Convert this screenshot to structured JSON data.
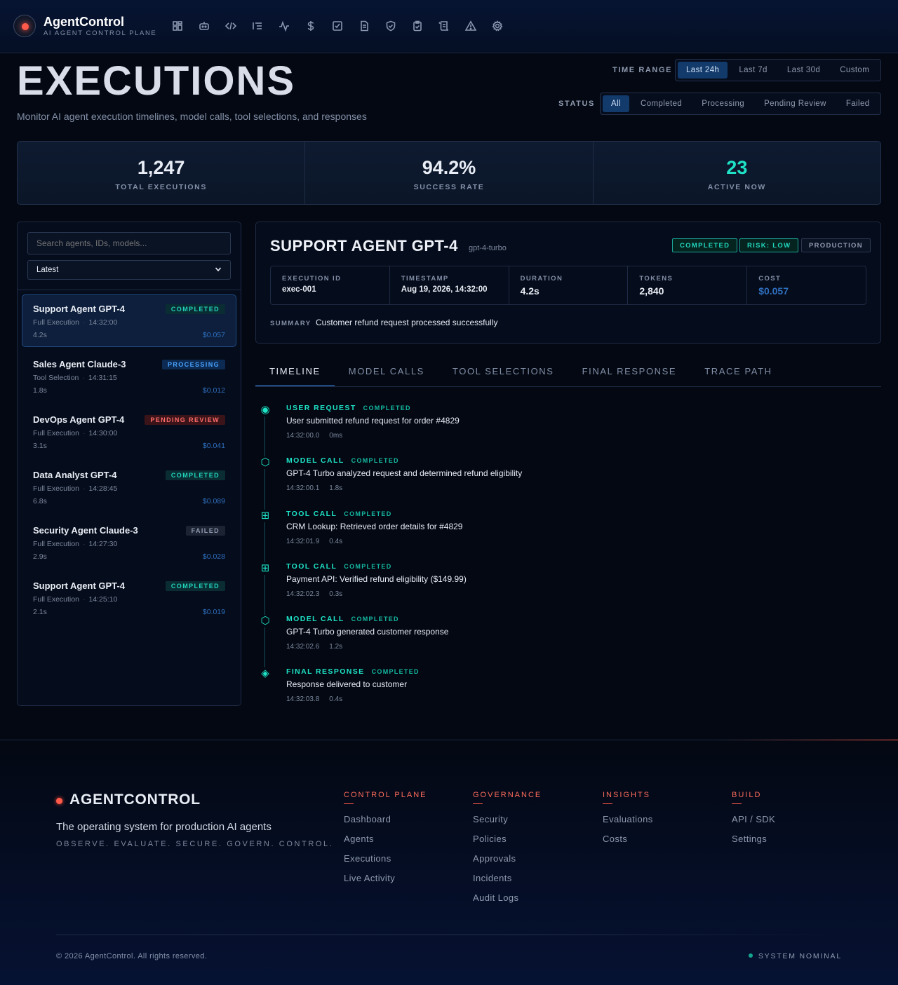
{
  "app": {
    "title": "AgentControl",
    "subtitle": "AI AGENT CONTROL PLANE"
  },
  "nav": {
    "icons": [
      "dashboard-icon",
      "agent-icon",
      "code-icon",
      "list-icon",
      "activity-icon",
      "dollar-icon",
      "checkbox-icon",
      "document-icon",
      "shield-icon",
      "clipboard-icon",
      "scroll-icon",
      "warning-icon",
      "gear-icon"
    ]
  },
  "page": {
    "title": "EXECUTIONS",
    "subtitle": "Monitor AI agent execution timelines, model calls, tool selections, and responses"
  },
  "filters": {
    "time_range_label": "TIME RANGE",
    "time_range_options": [
      "Last 24h",
      "Last 7d",
      "Last 30d",
      "Custom"
    ],
    "time_range_selected": "Last 24h",
    "status_label": "STATUS",
    "status_options": [
      "All",
      "Completed",
      "Processing",
      "Pending Review",
      "Failed"
    ],
    "status_selected": "All"
  },
  "stats": [
    {
      "value": "1,247",
      "label": "TOTAL EXECUTIONS"
    },
    {
      "value": "94.2%",
      "label": "SUCCESS RATE"
    },
    {
      "value": "23",
      "label": "ACTIVE NOW"
    }
  ],
  "list": {
    "search_placeholder": "Search agents, IDs, models...",
    "sort_value": "Latest",
    "items": [
      {
        "name": "Support Agent GPT-4",
        "status": "COMPLETED",
        "type": "Full Execution",
        "time": "14:32:00",
        "duration": "4.2s",
        "cost": "$0.057"
      },
      {
        "name": "Sales Agent Claude-3",
        "status": "PROCESSING",
        "type": "Tool Selection",
        "time": "14:31:15",
        "duration": "1.8s",
        "cost": "$0.012"
      },
      {
        "name": "DevOps Agent GPT-4",
        "status": "PENDING REVIEW",
        "type": "Full Execution",
        "time": "14:30:00",
        "duration": "3.1s",
        "cost": "$0.041"
      },
      {
        "name": "Data Analyst GPT-4",
        "status": "COMPLETED",
        "type": "Full Execution",
        "time": "14:28:45",
        "duration": "6.8s",
        "cost": "$0.089"
      },
      {
        "name": "Security Agent Claude-3",
        "status": "FAILED",
        "type": "Full Execution",
        "time": "14:27:30",
        "duration": "2.9s",
        "cost": "$0.028"
      },
      {
        "name": "Support Agent GPT-4",
        "status": "COMPLETED",
        "type": "Full Execution",
        "time": "14:25:10",
        "duration": "2.1s",
        "cost": "$0.019"
      }
    ]
  },
  "detail": {
    "title": "SUPPORT AGENT GPT-4",
    "model": "gpt-4-turbo",
    "tags": {
      "status": "COMPLETED",
      "risk": "RISK: LOW",
      "env": "PRODUCTION"
    },
    "meta": [
      {
        "label": "EXECUTION ID",
        "value": "exec-001"
      },
      {
        "label": "TIMESTAMP",
        "value": "Aug 19, 2026, 14:32:00"
      },
      {
        "label": "DURATION",
        "value": "4.2s"
      },
      {
        "label": "TOKENS",
        "value": "2,840"
      },
      {
        "label": "COST",
        "value": "$0.057"
      }
    ],
    "summary_label": "SUMMARY",
    "summary": "Customer refund request processed successfully"
  },
  "tabs": [
    "TIMELINE",
    "MODEL CALLS",
    "TOOL SELECTIONS",
    "FINAL RESPONSE",
    "TRACE PATH"
  ],
  "tabs_active": "TIMELINE",
  "timeline": [
    {
      "icon": "◉",
      "icon_name": "target-icon",
      "type": "USER REQUEST",
      "status": "COMPLETED",
      "desc": "User submitted refund request for order #4829",
      "time": "14:32:00.0",
      "dur": "0ms"
    },
    {
      "icon": "⬡",
      "icon_name": "hexagon-icon",
      "type": "MODEL CALL",
      "status": "COMPLETED",
      "desc": "GPT-4 Turbo analyzed request and determined refund eligibility",
      "time": "14:32:00.1",
      "dur": "1.8s"
    },
    {
      "icon": "⊞",
      "icon_name": "grid-icon",
      "type": "TOOL CALL",
      "status": "COMPLETED",
      "desc": "CRM Lookup: Retrieved order details for #4829",
      "time": "14:32:01.9",
      "dur": "0.4s"
    },
    {
      "icon": "⊞",
      "icon_name": "grid-icon",
      "type": "TOOL CALL",
      "status": "COMPLETED",
      "desc": "Payment API: Verified refund eligibility ($149.99)",
      "time": "14:32:02.3",
      "dur": "0.3s"
    },
    {
      "icon": "⬡",
      "icon_name": "hexagon-icon",
      "type": "MODEL CALL",
      "status": "COMPLETED",
      "desc": "GPT-4 Turbo generated customer response",
      "time": "14:32:02.6",
      "dur": "1.2s"
    },
    {
      "icon": "◈",
      "icon_name": "diamond-icon",
      "type": "FINAL RESPONSE",
      "status": "COMPLETED",
      "desc": "Response delivered to customer",
      "time": "14:32:03.8",
      "dur": "0.4s"
    }
  ],
  "footer": {
    "brand": "AGENTCONTROL",
    "tagline": "The operating system for production AI agents",
    "motto": "OBSERVE. EVALUATE. SECURE. GOVERN. CONTROL.",
    "columns": [
      {
        "title": "CONTROL PLANE",
        "links": [
          "Dashboard",
          "Agents",
          "Executions",
          "Live Activity"
        ]
      },
      {
        "title": "GOVERNANCE",
        "links": [
          "Security",
          "Policies",
          "Approvals",
          "Incidents",
          "Audit Logs"
        ]
      },
      {
        "title": "INSIGHTS",
        "links": [
          "Evaluations",
          "Costs"
        ]
      },
      {
        "title": "BUILD",
        "links": [
          "API / SDK",
          "Settings"
        ]
      }
    ],
    "copyright": "© 2026 AgentControl. All rights reserved.",
    "system_status": "SYSTEM NOMINAL"
  },
  "colors": {
    "accent_cyan": "#1ee3c7",
    "accent_blue": "#123a6b",
    "accent_red": "#ff5a4a",
    "background": "#030812"
  }
}
